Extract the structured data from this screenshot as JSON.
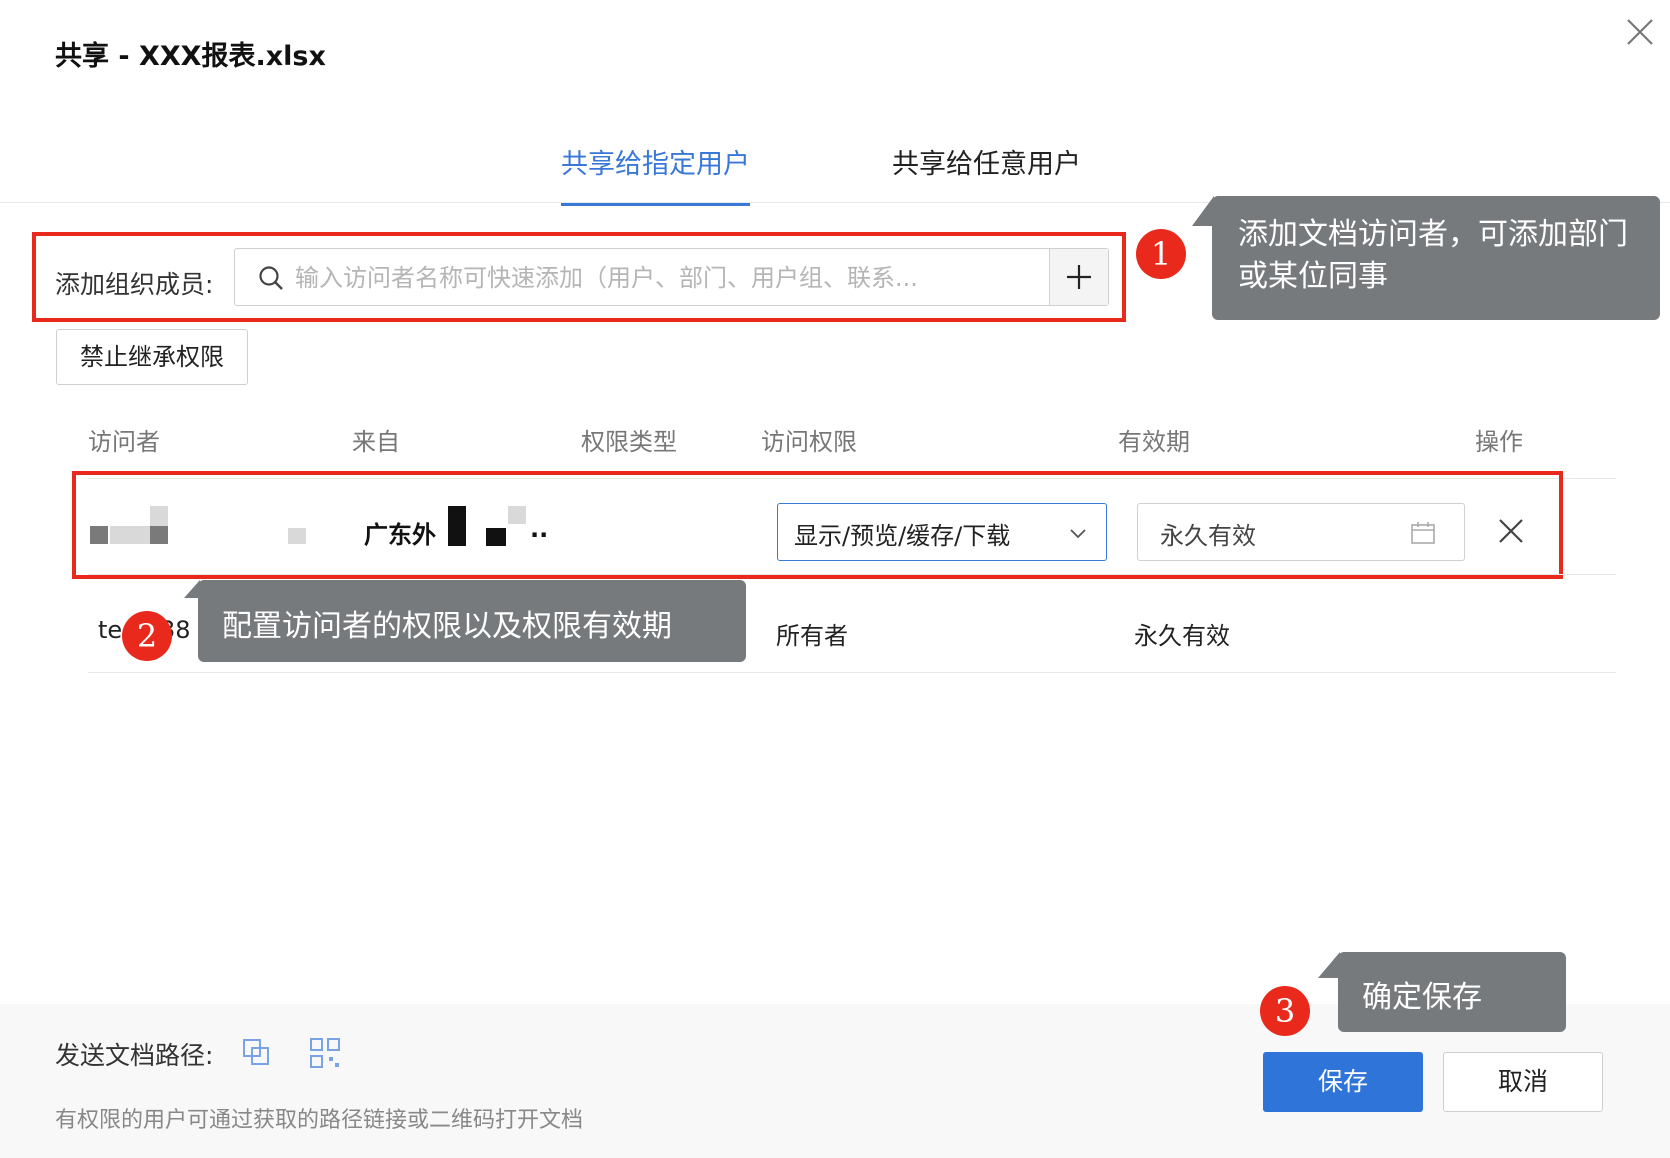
{
  "dialog": {
    "title": "共享 - XXX报表.xlsx"
  },
  "tabs": [
    {
      "label": "共享给指定用户"
    },
    {
      "label": "共享给任意用户"
    }
  ],
  "add_member": {
    "label": "添加组织成员:",
    "placeholder": "输入访问者名称可快速添加（用户、部门、用户组、联系..."
  },
  "disable_inherit_label": "禁止继承权限",
  "table": {
    "headers": [
      "访问者",
      "来自",
      "权限类型",
      "访问权限",
      "有效期",
      "操作"
    ],
    "rows": [
      {
        "from": "广东外",
        "from_suffix": "..",
        "permission": "显示/预览/缓存/下载",
        "validity": "永久有效"
      },
      {
        "visitor_prefix": "te",
        "visitor_suffix": "38",
        "access": "所有者",
        "validity": "永久有效"
      }
    ]
  },
  "annotations": [
    {
      "num": "1",
      "text": "添加文档访问者，可添加部门或某位同事"
    },
    {
      "num": "2",
      "text": "配置访问者的权限以及权限有效期"
    },
    {
      "num": "3",
      "text": "确定保存"
    }
  ],
  "footer": {
    "send_path_label": "发送文档路径:",
    "hint": "有权限的用户可通过获取的路径链接或二维码打开文档",
    "save_label": "保存",
    "cancel_label": "取消"
  },
  "colors": {
    "accent": "#3a78d8",
    "primary_button": "#2f74d9",
    "highlight_red": "#e8291c",
    "tooltip_bg": "#777a7d"
  },
  "icons": [
    "close-icon",
    "search-icon",
    "plus-icon",
    "chevron-down-icon",
    "calendar-icon",
    "delete-icon",
    "copy-link-icon",
    "qrcode-icon"
  ]
}
